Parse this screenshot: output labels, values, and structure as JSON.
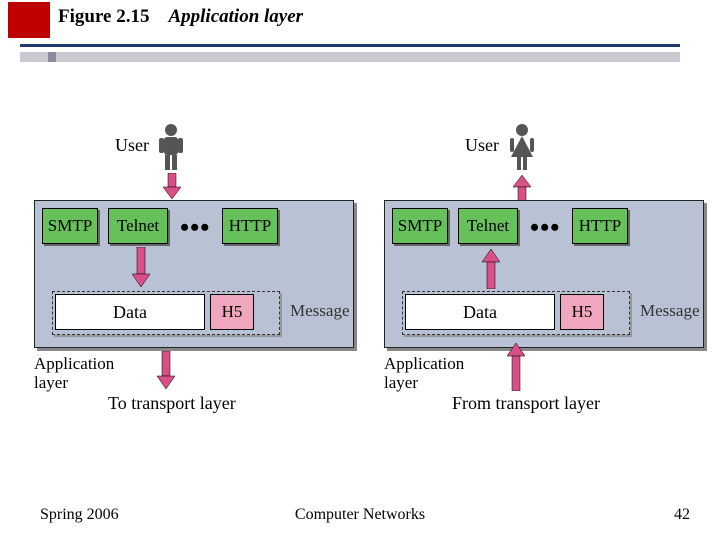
{
  "header": {
    "figure_number": "Figure 2.15",
    "figure_name": "Application layer"
  },
  "left": {
    "user_label": "User",
    "protocols": {
      "smtp": "SMTP",
      "telnet": "Telnet",
      "ellipsis": "•••",
      "http": "HTTP"
    },
    "data_label": "Data",
    "h5_label": "H5",
    "message_label": "Message",
    "app_layer_label": "Application\nlayer",
    "transport_label": "To transport layer"
  },
  "right": {
    "user_label": "User",
    "protocols": {
      "smtp": "SMTP",
      "telnet": "Telnet",
      "ellipsis": "•••",
      "http": "HTTP"
    },
    "data_label": "Data",
    "h5_label": "H5",
    "message_label": "Message",
    "app_layer_label": "Application\nlayer",
    "transport_label": "From transport layer"
  },
  "footer": {
    "term": "Spring 2006",
    "course": "Computer Networks",
    "page": "42"
  },
  "colors": {
    "accent_red": "#c00000",
    "panel": "#b9c1d4",
    "protocol_green": "#66c15b",
    "header_pink": "#f0a6bd",
    "arrow_pink": "#d94f88"
  }
}
